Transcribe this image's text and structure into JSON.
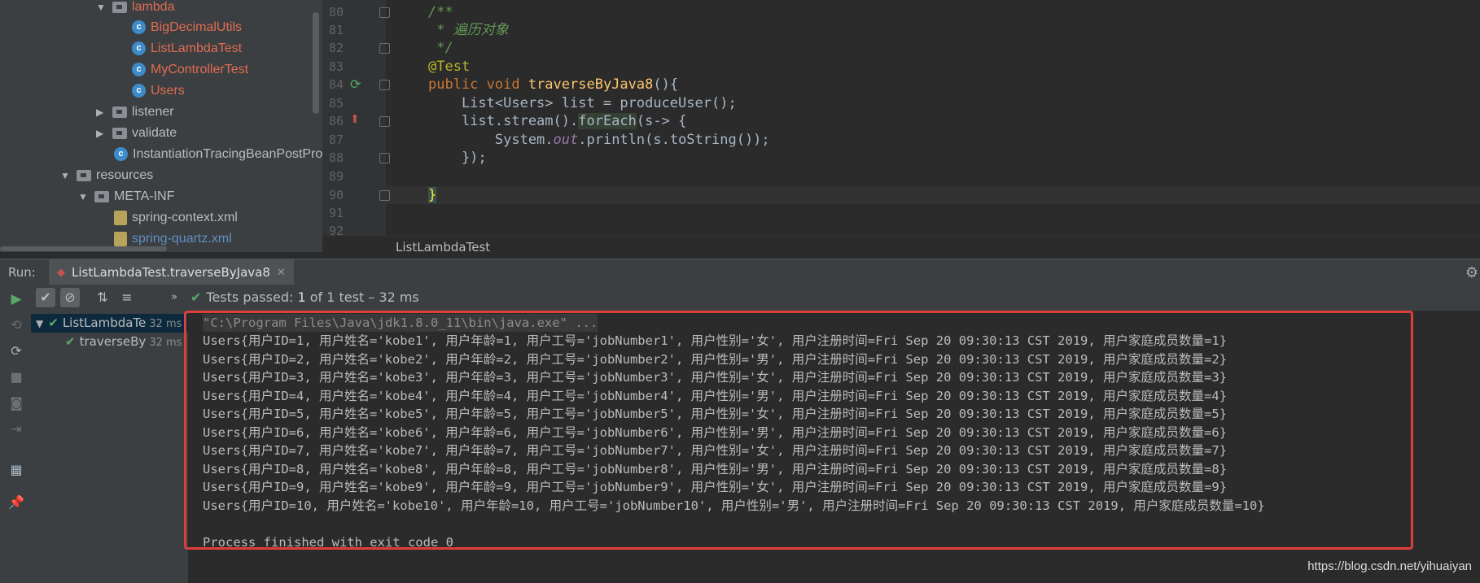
{
  "project_tree": {
    "items": [
      {
        "label": "lambda",
        "kind": "folder",
        "color": "red",
        "expanded": true
      },
      {
        "label": "BigDecimalUtils",
        "kind": "class",
        "color": "red"
      },
      {
        "label": "ListLambdaTest",
        "kind": "class",
        "color": "red"
      },
      {
        "label": "MyControllerTest",
        "kind": "class",
        "color": "red"
      },
      {
        "label": "Users",
        "kind": "class",
        "color": "red"
      },
      {
        "label": "listener",
        "kind": "folder",
        "expanded": false
      },
      {
        "label": "validate",
        "kind": "folder",
        "expanded": false
      },
      {
        "label": "InstantiationTracingBeanPostPro",
        "kind": "class"
      },
      {
        "label": "resources",
        "kind": "folder",
        "expanded": true
      },
      {
        "label": "META-INF",
        "kind": "folder",
        "expanded": true
      },
      {
        "label": "spring-context.xml",
        "kind": "xml"
      },
      {
        "label": "spring-quartz.xml",
        "kind": "xml",
        "color": "blue"
      }
    ]
  },
  "editor": {
    "line_numbers": [
      "80",
      "81",
      "82",
      "83",
      "84",
      "85",
      "86",
      "87",
      "88",
      "89",
      "90",
      "91",
      "92"
    ],
    "code": {
      "l80": "/**",
      "l81": " * 遍历对象",
      "l82": " */",
      "l83": "@Test",
      "l84_kw": "public void ",
      "l84_fn": "traverseByJava8",
      "l84_rest": "(){",
      "l85": "    List<Users> list = produceUser();",
      "l86_a": "    list.stream().",
      "l86_b": "forEach",
      "l86_c": "(s-> {",
      "l87_a": "        System.",
      "l87_b": "out",
      "l87_c": ".println(s.toString());",
      "l88": "    });",
      "l90": "}"
    },
    "breadcrumb": "ListLambdaTest"
  },
  "run_panel": {
    "label": "Run:",
    "tab_title": "ListLambdaTest.traverseByJava8",
    "status_prefix": "Tests passed: ",
    "status_count": "1",
    "status_suffix": " of 1 test – 32 ms",
    "test_tree": [
      {
        "label": "ListLambdaTe",
        "time": "32 ms"
      },
      {
        "label": "traverseBy",
        "time": "32 ms"
      }
    ]
  },
  "console": {
    "command": "\"C:\\Program Files\\Java\\jdk1.8.0_11\\bin\\java.exe\" ...",
    "lines": [
      "Users{用户ID=1, 用户姓名='kobe1', 用户年龄=1, 用户工号='jobNumber1', 用户性别='女', 用户注册时间=Fri Sep 20 09:30:13 CST 2019, 用户家庭成员数量=1}",
      "Users{用户ID=2, 用户姓名='kobe2', 用户年龄=2, 用户工号='jobNumber2', 用户性别='男', 用户注册时间=Fri Sep 20 09:30:13 CST 2019, 用户家庭成员数量=2}",
      "Users{用户ID=3, 用户姓名='kobe3', 用户年龄=3, 用户工号='jobNumber3', 用户性别='女', 用户注册时间=Fri Sep 20 09:30:13 CST 2019, 用户家庭成员数量=3}",
      "Users{用户ID=4, 用户姓名='kobe4', 用户年龄=4, 用户工号='jobNumber4', 用户性别='男', 用户注册时间=Fri Sep 20 09:30:13 CST 2019, 用户家庭成员数量=4}",
      "Users{用户ID=5, 用户姓名='kobe5', 用户年龄=5, 用户工号='jobNumber5', 用户性别='女', 用户注册时间=Fri Sep 20 09:30:13 CST 2019, 用户家庭成员数量=5}",
      "Users{用户ID=6, 用户姓名='kobe6', 用户年龄=6, 用户工号='jobNumber6', 用户性别='男', 用户注册时间=Fri Sep 20 09:30:13 CST 2019, 用户家庭成员数量=6}",
      "Users{用户ID=7, 用户姓名='kobe7', 用户年龄=7, 用户工号='jobNumber7', 用户性别='女', 用户注册时间=Fri Sep 20 09:30:13 CST 2019, 用户家庭成员数量=7}",
      "Users{用户ID=8, 用户姓名='kobe8', 用户年龄=8, 用户工号='jobNumber8', 用户性别='男', 用户注册时间=Fri Sep 20 09:30:13 CST 2019, 用户家庭成员数量=8}",
      "Users{用户ID=9, 用户姓名='kobe9', 用户年龄=9, 用户工号='jobNumber9', 用户性别='女', 用户注册时间=Fri Sep 20 09:30:13 CST 2019, 用户家庭成员数量=9}",
      "Users{用户ID=10, 用户姓名='kobe10', 用户年龄=10, 用户工号='jobNumber10', 用户性别='男', 用户注册时间=Fri Sep 20 09:30:13 CST 2019, 用户家庭成员数量=10}"
    ],
    "exit": "Process finished with exit code 0"
  },
  "watermark": "https://blog.csdn.net/yihuaiyan",
  "colors": {
    "highlight_box": "#e03d3d",
    "pass_green": "#59a869",
    "annotation": "#bbb529",
    "keyword": "#cc7832",
    "function": "#ffc66d",
    "comment": "#629755"
  }
}
